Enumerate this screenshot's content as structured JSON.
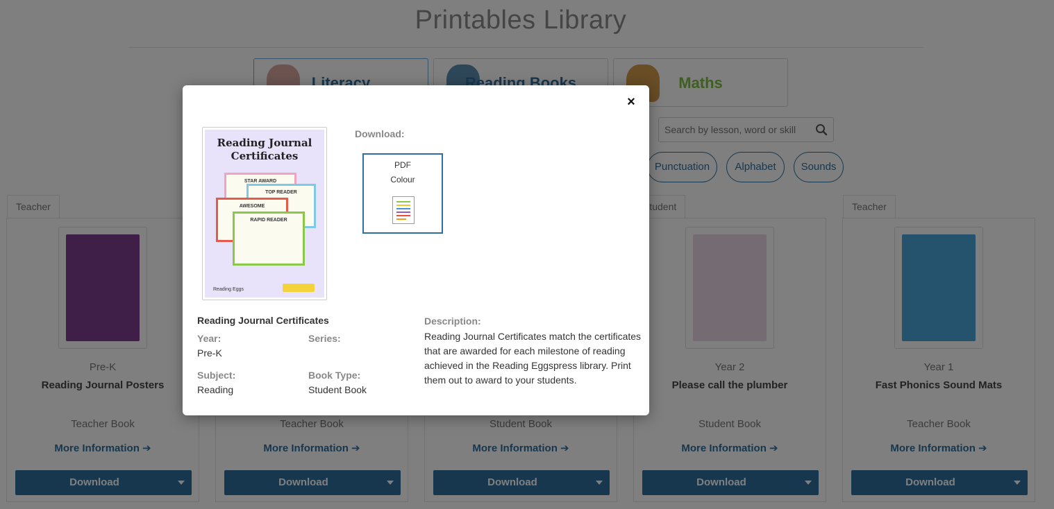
{
  "page": {
    "title": "Printables Library",
    "categories": [
      {
        "label": "Literacy",
        "color": "#2f6f9f",
        "figure_color": "#d9a7a1"
      },
      {
        "label": "Reading Books",
        "color": "#2f6f9f",
        "figure_color": "#5d8fb0"
      },
      {
        "label": "Maths",
        "color": "#7cbf3a",
        "figure_color": "#d19a4b"
      }
    ],
    "search": {
      "placeholder": "Search by lesson, word or skill"
    },
    "filters": [
      "Punctuation",
      "Alphabet",
      "Sounds"
    ],
    "cards": [
      {
        "tag": "Teacher",
        "year": "Pre-K",
        "name": "Reading Journal Posters",
        "book_type": "Teacher Book",
        "more": "More Information",
        "download": "Download",
        "cover_color": "#7e3c8f"
      },
      {
        "tag": "",
        "year": "",
        "name": "",
        "book_type": "Teacher Book",
        "more": "More Information",
        "download": "Download",
        "cover_color": "#cccccc"
      },
      {
        "tag": "",
        "year": "",
        "name": "",
        "book_type": "Student Book",
        "more": "More Information",
        "download": "Download",
        "cover_color": "#cccccc"
      },
      {
        "tag": "Student",
        "year": "Year 2",
        "name": "Please call the plumber",
        "book_type": "Student Book",
        "more": "More Information",
        "download": "Download",
        "cover_color": "#e9d8e4"
      },
      {
        "tag": "Teacher",
        "year": "Year 1",
        "name": "Fast Phonics Sound Mats",
        "book_type": "Teacher Book",
        "more": "More Information",
        "download": "Download",
        "cover_color": "#4aa4d8"
      }
    ]
  },
  "modal": {
    "close_label": "×",
    "cover": {
      "title": "Reading Journal Certificates",
      "certificates": [
        "STAR AWARD",
        "TOP READER",
        "AWESOME",
        "RAPID READER"
      ],
      "brand": "Reading Eggs"
    },
    "download_heading": "Download:",
    "download_option": {
      "format": "PDF",
      "variant": "Colour"
    },
    "title": "Reading Journal Certificates",
    "fields": {
      "year_label": "Year:",
      "year_value": "Pre-K",
      "series_label": "Series:",
      "series_value": "",
      "subject_label": "Subject:",
      "subject_value": "Reading",
      "book_type_label": "Book Type:",
      "book_type_value": "Student Book"
    },
    "description_label": "Description:",
    "description": "Reading Journal Certificates match the certificates that are awarded for each milestone of reading achieved in the Reading Eggspress library. Print them out to award to your students."
  },
  "colors": {
    "accent": "#2f6f9f",
    "maths": "#7cbf3a",
    "overlay": "rgba(0,0,0,0.5)"
  }
}
